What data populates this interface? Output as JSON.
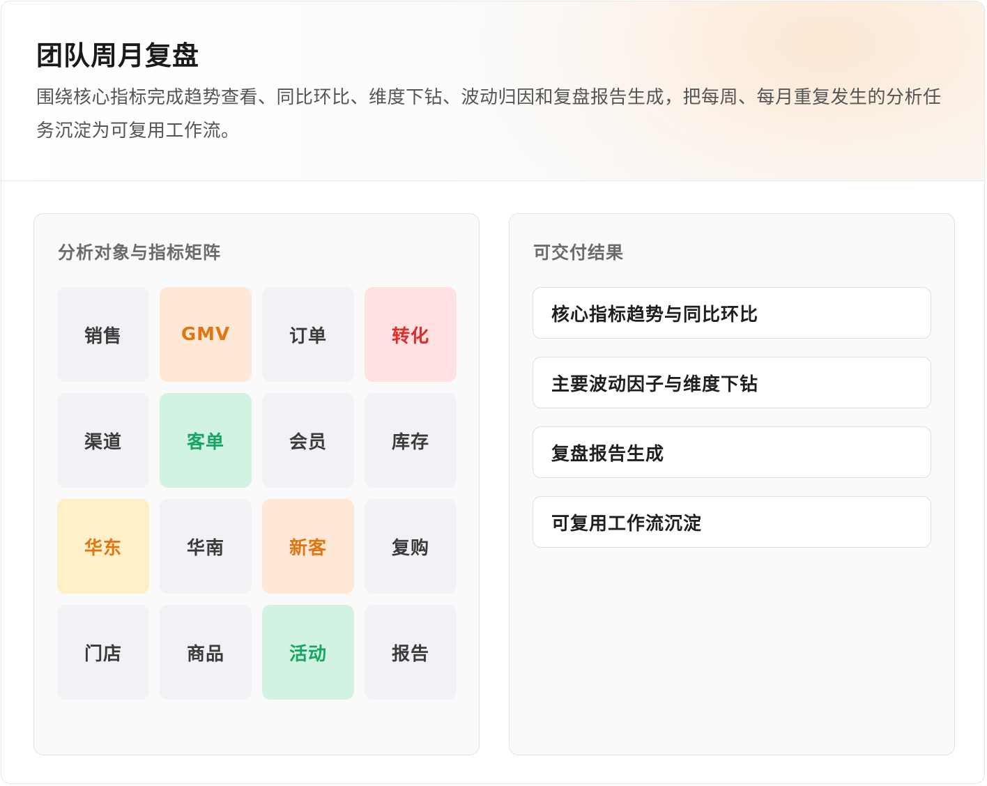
{
  "header": {
    "title": "团队周月复盘",
    "description": "围绕核心指标完成趋势查看、同比环比、维度下钻、波动归因和复盘报告生成，把每周、每月重复发生的分析任务沉淀为可复用工作流。"
  },
  "matrix": {
    "title": "分析对象与指标矩阵",
    "tiles": [
      {
        "label": "销售",
        "tone": "gray"
      },
      {
        "label": "GMV",
        "tone": "orange"
      },
      {
        "label": "订单",
        "tone": "gray"
      },
      {
        "label": "转化",
        "tone": "red"
      },
      {
        "label": "渠道",
        "tone": "gray"
      },
      {
        "label": "客单",
        "tone": "green"
      },
      {
        "label": "会员",
        "tone": "gray"
      },
      {
        "label": "库存",
        "tone": "gray"
      },
      {
        "label": "华东",
        "tone": "yellow"
      },
      {
        "label": "华南",
        "tone": "gray"
      },
      {
        "label": "新客",
        "tone": "orange"
      },
      {
        "label": "复购",
        "tone": "gray"
      },
      {
        "label": "门店",
        "tone": "gray"
      },
      {
        "label": "商品",
        "tone": "gray"
      },
      {
        "label": "活动",
        "tone": "green"
      },
      {
        "label": "报告",
        "tone": "gray"
      }
    ]
  },
  "deliverables": {
    "title": "可交付结果",
    "items": [
      {
        "label": "核心指标趋势与同比环比"
      },
      {
        "label": "主要波动因子与维度下钻"
      },
      {
        "label": "复盘报告生成"
      },
      {
        "label": "可复用工作流沉淀"
      }
    ]
  },
  "colors": {
    "orange_text": "#e07512",
    "red_text": "#df2b2b",
    "green_text": "#16a562",
    "gray_tile": "#f1f2f5",
    "orange_tile": "#ffe9d6",
    "red_tile": "#ffe1e1",
    "green_tile": "#d2f3e1",
    "yellow_tile": "#fff0c8"
  }
}
